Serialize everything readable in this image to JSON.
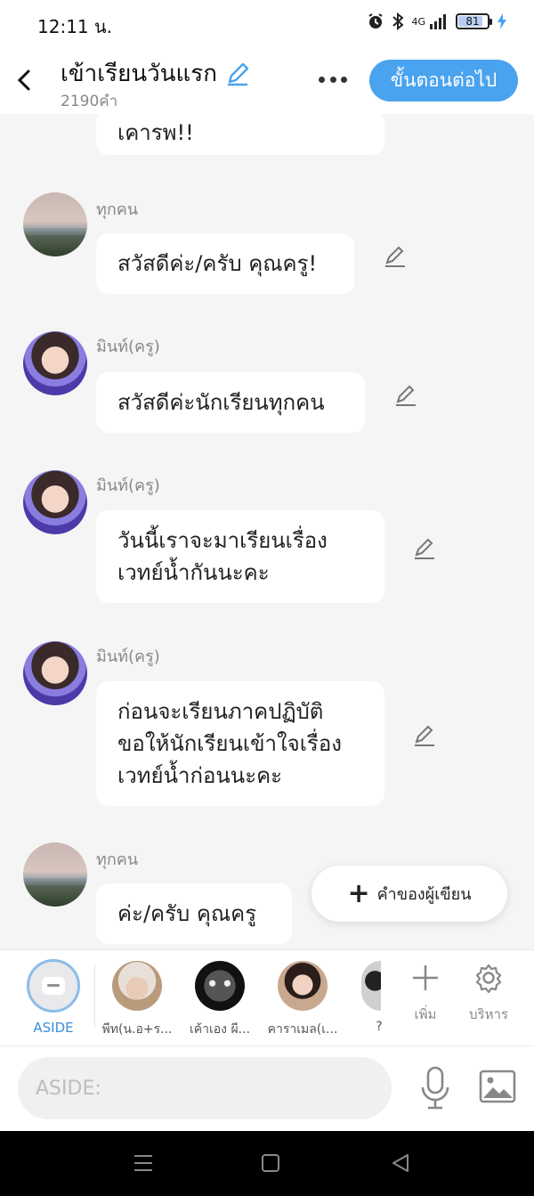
{
  "status": {
    "time": "12:11 น.",
    "network": "4G",
    "battery": "81"
  },
  "header": {
    "title": "เข้าเรียนวันแรก",
    "word_count": "2190คำ",
    "next_button": "ขั้นตอนต่อไป"
  },
  "chat": {
    "partial_text": "เคารพ!!",
    "messages": [
      {
        "speaker": "ทุกคน",
        "lines": [
          "สวัสดีค่ะ/ครับ คุณครู!"
        ]
      },
      {
        "speaker": "มินท์(ครู)",
        "lines": [
          "สวัสดีค่ะนักเรียนทุกคน"
        ]
      },
      {
        "speaker": "มินท์(ครู)",
        "lines": [
          "วันนี้เราจะมาเรียนเรื่อง",
          "เวทย์น้ำกันนะคะ"
        ]
      },
      {
        "speaker": "มินท์(ครู)",
        "lines": [
          "ก่อนจะเรียนภาคปฏิบัติ",
          "ขอให้นักเรียนเข้าใจเรื่อง",
          "เวทย์น้ำก่อนนะคะ"
        ]
      },
      {
        "speaker": "ทุกคน",
        "lines": [
          "ค่ะ/ครับ คุณครู"
        ]
      }
    ],
    "author_button": "คำของผู้เขียน"
  },
  "characters": {
    "aside_label": "ASIDE",
    "items": [
      {
        "label": "พีท(น.อ+ร..."
      },
      {
        "label": "เค้าเอง ผี..."
      },
      {
        "label": "คาราเมล(เ..."
      },
      {
        "label": "?"
      }
    ],
    "add_label": "เพิ่ม",
    "manage_label": "บริหาร"
  },
  "input": {
    "placeholder": "ASIDE:"
  }
}
